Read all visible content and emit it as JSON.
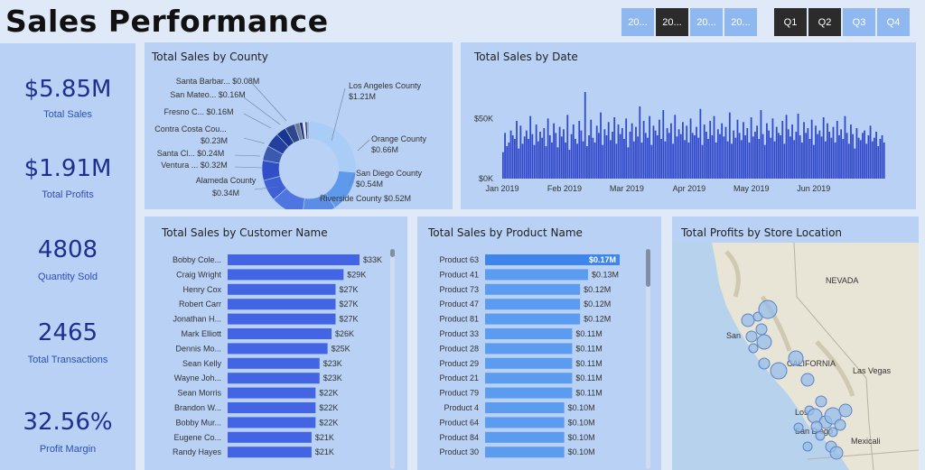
{
  "header": {
    "title": "Sales Performance",
    "year_buttons": [
      {
        "label": "20...",
        "selected": false
      },
      {
        "label": "20...",
        "selected": true
      },
      {
        "label": "20...",
        "selected": false
      },
      {
        "label": "20...",
        "selected": false
      }
    ],
    "quarter_buttons": [
      {
        "label": "Q1",
        "selected": true
      },
      {
        "label": "Q2",
        "selected": true
      },
      {
        "label": "Q3",
        "selected": false
      },
      {
        "label": "Q4",
        "selected": false
      }
    ]
  },
  "kpis": [
    {
      "value": "$5.85M",
      "label": "Total Sales"
    },
    {
      "value": "$1.91M",
      "label": "Total Profits"
    },
    {
      "value": "4808",
      "label": "Quantity Sold"
    },
    {
      "value": "2465",
      "label": "Total Transactions"
    },
    {
      "value": "32.56%",
      "label": "Profit Margin"
    }
  ],
  "panels": {
    "county": "Total Sales by County",
    "date": "Total Sales by Date",
    "customer": "Total Sales by Customer Name",
    "product": "Total Sales by Product Name",
    "map": "Total Profits by Store Location"
  },
  "map_labels": {
    "nevada": "NEVADA",
    "california": "CALIFORNIA",
    "las_vegas": "Las Vegas",
    "san_francisco": "San",
    "los_angeles": "Los",
    "san_diego": "San Diego",
    "mexicali": "Mexicali"
  },
  "chart_data": [
    {
      "type": "pie",
      "title": "Total Sales by County",
      "donut": true,
      "slices": [
        {
          "label": "Los Angeles County",
          "value_text": "$1.21M",
          "value": 1.21,
          "color": "#a9cdf7"
        },
        {
          "label": "Orange County",
          "value_text": "$0.66M",
          "value": 0.66,
          "color": "#5f99eb"
        },
        {
          "label": "San Diego County",
          "value_text": "$0.54M",
          "value": 0.54,
          "color": "#5b8de6"
        },
        {
          "label": "Riverside County",
          "value_text": "$0.52M",
          "value": 0.52,
          "color": "#4f76e0"
        },
        {
          "label": "Alameda County",
          "value_text": "$0.34M",
          "value": 0.34,
          "color": "#3f5fd6"
        },
        {
          "label": "Ventura ...",
          "value_text": "$0.32M",
          "value": 0.32,
          "color": "#2f4ec8"
        },
        {
          "label": "Santa Cl...",
          "value_text": "$0.24M",
          "value": 0.24,
          "color": "#3a5ab0"
        },
        {
          "label": "Contra Costa Cou...",
          "value_text": "$0.23M",
          "value": 0.23,
          "color": "#243f9e"
        },
        {
          "label": "Fresno C...",
          "value_text": "$0.16M",
          "value": 0.16,
          "color": "#1a3590"
        },
        {
          "label": "San Mateo...",
          "value_text": "$0.16M",
          "value": 0.16,
          "color": "#30468a"
        },
        {
          "label": "Santa Barbar...",
          "value_text": "$0.08M",
          "value": 0.08,
          "color": "#6d7d9e"
        },
        {
          "label": "",
          "value_text": "",
          "value": 0.05,
          "color": "#223070"
        },
        {
          "label": "",
          "value_text": "",
          "value": 0.04,
          "color": "#dde3ec"
        },
        {
          "label": "",
          "value_text": "",
          "value": 0.03,
          "color": "#1c2a60"
        },
        {
          "label": "",
          "value_text": "",
          "value": 0.03,
          "color": "#90a2c8"
        }
      ]
    },
    {
      "type": "bar",
      "title": "Total Sales by Date",
      "y_ticks": [
        "$50K",
        "$0K"
      ],
      "y_tick_values": [
        50,
        0
      ],
      "x_ticks": [
        "Jan 2019",
        "Feb 2019",
        "Mar 2019",
        "Apr 2019",
        "May 2019",
        "Jun 2019"
      ],
      "ylim": [
        0,
        75
      ],
      "unit": "$K",
      "values": [
        22,
        38,
        27,
        30,
        40,
        36,
        33,
        48,
        25,
        44,
        29,
        35,
        40,
        33,
        52,
        37,
        28,
        45,
        31,
        39,
        34,
        42,
        27,
        50,
        36,
        30,
        46,
        38,
        26,
        43,
        35,
        41,
        30,
        53,
        24,
        37,
        45,
        33,
        29,
        48,
        40,
        31,
        72,
        27,
        36,
        49,
        34,
        30,
        44,
        38,
        55,
        28,
        41,
        36,
        47,
        32,
        39,
        51,
        29,
        45,
        37,
        42,
        33,
        50,
        26,
        39,
        46,
        31,
        43,
        35,
        60,
        30,
        48,
        38,
        34,
        52,
        28,
        44,
        40,
        36,
        49,
        33,
        57,
        31,
        42,
        38,
        46,
        29,
        53,
        35,
        41,
        37,
        47,
        32,
        44,
        30,
        50,
        38,
        36,
        43,
        34,
        58,
        28,
        45,
        39,
        33,
        48,
        36,
        52,
        30,
        41,
        37,
        46,
        35,
        43,
        31,
        55,
        29,
        40,
        34,
        49,
        38,
        32,
        47,
        36,
        42,
        30,
        51,
        35,
        39,
        44,
        33,
        57,
        37,
        28,
        46,
        40,
        34,
        50,
        31,
        43,
        38,
        36,
        48,
        29,
        53,
        41,
        35,
        45,
        32,
        39,
        54,
        36,
        30,
        47,
        38,
        42,
        33,
        49,
        28,
        44,
        37,
        40,
        35,
        51,
        31,
        46,
        39,
        34,
        43,
        30,
        48,
        36,
        41,
        33,
        52,
        38,
        29,
        45,
        37,
        25,
        42,
        34,
        32,
        38,
        40,
        29,
        36,
        44,
        31,
        34,
        39,
        27,
        33,
        36,
        30
      ]
    },
    {
      "type": "bar",
      "orientation": "horizontal",
      "title": "Total Sales by Customer Name",
      "unit": "$K",
      "categories": [
        "Bobby Cole...",
        "Craig Wright",
        "Henry Cox",
        "Robert Carr",
        "Jonathan H...",
        "Mark Elliott",
        "Dennis Mo...",
        "Sean Kelly",
        "Wayne Joh...",
        "Sean Morris",
        "Brandon W...",
        "Bobby Mur...",
        "Eugene Co...",
        "Randy Hayes"
      ],
      "values": [
        33,
        29,
        27,
        27,
        27,
        26,
        25,
        23,
        23,
        22,
        22,
        22,
        21,
        21
      ],
      "value_labels": [
        "$33K",
        "$29K",
        "$27K",
        "$27K",
        "$27K",
        "$26K",
        "$25K",
        "$23K",
        "$23K",
        "$22K",
        "$22K",
        "$22K",
        "$21K",
        "$21K"
      ]
    },
    {
      "type": "bar",
      "orientation": "horizontal",
      "title": "Total Sales by Product Name",
      "unit": "$M",
      "categories": [
        "Product 63",
        "Product 41",
        "Product 73",
        "Product 47",
        "Product 81",
        "Product 33",
        "Product 28",
        "Product 29",
        "Product 21",
        "Product 79",
        "Product 4",
        "Product 64",
        "Product 84",
        "Product 30"
      ],
      "values": [
        0.17,
        0.13,
        0.12,
        0.12,
        0.12,
        0.11,
        0.11,
        0.11,
        0.11,
        0.11,
        0.1,
        0.1,
        0.1,
        0.1
      ],
      "value_labels": [
        "$0.17M",
        "$0.13M",
        "$0.12M",
        "$0.12M",
        "$0.12M",
        "$0.11M",
        "$0.11M",
        "$0.11M",
        "$0.11M",
        "$0.11M",
        "$0.10M",
        "$0.10M",
        "$0.10M",
        "$0.10M"
      ]
    }
  ]
}
